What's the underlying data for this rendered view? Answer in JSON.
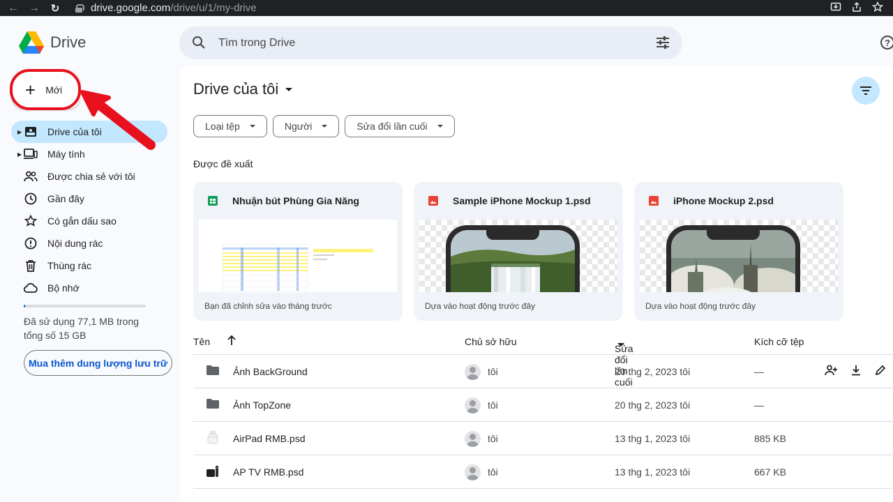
{
  "browser": {
    "url_host": "drive.google.com",
    "url_path": "/drive/u/1/my-drive"
  },
  "app": {
    "name": "Drive"
  },
  "new_button": {
    "label": "Mới"
  },
  "sidebar": {
    "items": [
      {
        "label": "Drive của tôi",
        "icon": "my-drive-icon",
        "active": true
      },
      {
        "label": "Máy tính",
        "icon": "computer-icon"
      },
      {
        "label": "Được chia sẻ với tôi",
        "icon": "shared-icon"
      },
      {
        "label": "Gần đây",
        "icon": "clock-icon"
      },
      {
        "label": "Có gắn dấu sao",
        "icon": "star-icon"
      },
      {
        "label": "Nội dung rác",
        "icon": "spam-icon"
      },
      {
        "label": "Thùng rác",
        "icon": "trash-icon"
      },
      {
        "label": "Bộ nhớ",
        "icon": "cloud-icon"
      }
    ],
    "storage": {
      "text": "Đã sử dụng 77,1 MB trong tổng số 15 GB",
      "used_fraction": 0.005
    },
    "buy_storage_label": "Mua thêm dung lượng lưu trữ"
  },
  "search": {
    "placeholder": "Tìm trong Drive"
  },
  "main": {
    "title": "Drive của tôi",
    "chips": [
      "Loại tệp",
      "Người",
      "Sửa đổi lần cuối"
    ],
    "suggested_label": "Được đề xuất",
    "cards": [
      {
        "name": "Nhuận bút Phùng Gia Năng",
        "type": "sheets",
        "note": "Bạn đã chỉnh sửa vào tháng trước"
      },
      {
        "name": "Sample iPhone Mockup 1.psd",
        "type": "image",
        "note": "Dựa vào hoạt động trước đây"
      },
      {
        "name": "iPhone Mockup 2.psd",
        "type": "image",
        "note": "Dựa vào hoạt động trước đây"
      }
    ],
    "table": {
      "headers": {
        "name": "Tên",
        "owner": "Chủ sở hữu",
        "modified": "Sửa đổi lần cuối",
        "size": "Kích cỡ tệp"
      },
      "rows": [
        {
          "name": "Ảnh BackGround",
          "kind": "folder",
          "owner": "tôi",
          "modified": "20 thg 2, 2023 tôi",
          "size": "—"
        },
        {
          "name": "Ảnh TopZone",
          "kind": "folder",
          "owner": "tôi",
          "modified": "20 thg 2, 2023 tôi",
          "size": "—"
        },
        {
          "name": "AirPad RMB.psd",
          "kind": "airpods",
          "owner": "tôi",
          "modified": "13 thg 1, 2023 tôi",
          "size": "885 KB"
        },
        {
          "name": "AP TV RMB.psd",
          "kind": "appletv",
          "owner": "tôi",
          "modified": "13 thg 1, 2023 tôi",
          "size": "667 KB"
        }
      ]
    }
  },
  "colors": {
    "accent": "#0b57d0",
    "active_nav": "#c2e7ff",
    "highlight": "#e8101c"
  }
}
